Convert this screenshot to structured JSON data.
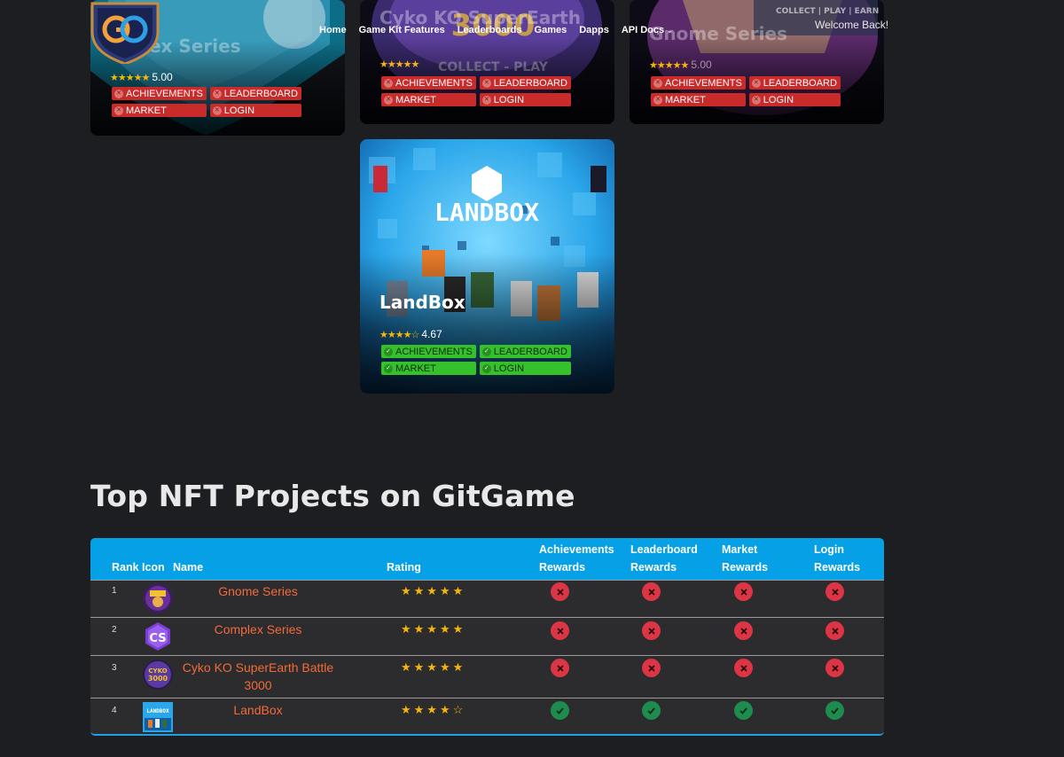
{
  "header": {
    "nav": [
      {
        "label": "Home"
      },
      {
        "label": "Game Kit Features"
      },
      {
        "label": "Leaderboards"
      },
      {
        "label": "Games"
      },
      {
        "label": "Dapps"
      },
      {
        "label": "API Docs"
      }
    ],
    "welcome": "Welcome Back!",
    "logo_icon": "gitgame-shield-logo"
  },
  "cards": [
    {
      "title": "Complex Series",
      "title_visible": "...plex Series",
      "rating": "5.00",
      "stars": 5,
      "badges": [
        "ACHIEVEMENTS",
        "LEADERBOARD",
        "MARKET",
        "LOGIN"
      ],
      "status": "disabled"
    },
    {
      "title": "Cyko KO SuperEarth",
      "rating": "",
      "stars": 5,
      "badges": [
        "ACHIEVEMENTS",
        "LEADERBOARD",
        "MARKET",
        "LOGIN"
      ],
      "status": "disabled",
      "art_text": "COLLECT - PLAY"
    },
    {
      "title": "Gnome Series",
      "rating": "5.00",
      "stars": 5,
      "badges": [
        "ACHIEVEMENTS",
        "LEADERBOARD",
        "MARKET",
        "LOGIN"
      ],
      "status": "disabled",
      "art_text": "COLLECT | PLAY | EARN"
    },
    {
      "title": "LandBox",
      "rating": "4.67",
      "stars": 4.67,
      "badges": [
        "ACHIEVEMENTS",
        "LEADERBOARD",
        "MARKET",
        "LOGIN"
      ],
      "status": "enabled",
      "art_text": "LANDBOX"
    }
  ],
  "section_title": "Top NFT Projects on GitGame",
  "table": {
    "headers": {
      "rank": "Rank",
      "icon": "Icon",
      "name": "Name",
      "rating": "Rating",
      "ach_1": "Achievements",
      "ach_2": "Rewards",
      "lead_1": "Leaderboard",
      "lead_2": "Rewards",
      "market_1": "Market",
      "market_2": "Rewards",
      "login_1": "Login",
      "login_2": "Rewards"
    },
    "rows": [
      {
        "rank": "1",
        "name": "Gnome Series",
        "stars": 5,
        "achievements": false,
        "leaderboard": false,
        "market": false,
        "login": false
      },
      {
        "rank": "2",
        "name": "Complex Series",
        "stars": 5,
        "achievements": false,
        "leaderboard": false,
        "market": false,
        "login": false
      },
      {
        "rank": "3",
        "name": "Cyko KO SuperEarth Battle 3000",
        "stars": 5,
        "achievements": false,
        "leaderboard": false,
        "market": false,
        "login": false
      },
      {
        "rank": "4",
        "name": "LandBox",
        "stars": 4.5,
        "achievements": true,
        "leaderboard": true,
        "market": true,
        "login": true
      }
    ]
  },
  "colors": {
    "accent": "#06a0e6",
    "link": "#f26a3a",
    "no": "#dc3545",
    "yes": "#1e8c4e",
    "star": "#f5b50a",
    "badge_red": "#c92a2a",
    "badge_green": "#35c12c"
  }
}
